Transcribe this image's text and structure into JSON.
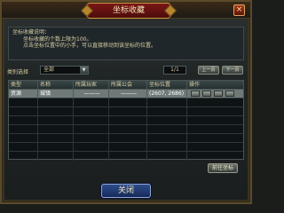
{
  "window": {
    "title": "坐标收藏",
    "close_glyph": "×"
  },
  "description": {
    "heading": "坐标收藏说明：",
    "lines": [
      "坐标收藏的个数上限为100。",
      "点击坐标位置中的小手，可以直接移动到该坐标的位置。"
    ]
  },
  "filter": {
    "label": "类别选择",
    "selected_category": "全部",
    "page_indicator": "1/1",
    "prev_label": "上一页",
    "next_label": "下一页"
  },
  "table": {
    "columns": [
      "类型",
      "名称",
      "所属玩家",
      "所属公会",
      "坐标位置",
      "操作"
    ],
    "rows": [
      {
        "type": "资源",
        "name": "城镇",
        "player": "———",
        "guild": "———",
        "coords": "(2607, 2686)"
      },
      {
        "type": "",
        "name": "",
        "player": "",
        "guild": "",
        "coords": ""
      },
      {
        "type": "",
        "name": "",
        "player": "",
        "guild": "",
        "coords": ""
      },
      {
        "type": "",
        "name": "",
        "player": "",
        "guild": "",
        "coords": ""
      },
      {
        "type": "",
        "name": "",
        "player": "",
        "guild": "",
        "coords": ""
      },
      {
        "type": "",
        "name": "",
        "player": "",
        "guild": "",
        "coords": ""
      },
      {
        "type": "",
        "name": "",
        "player": "",
        "guild": "",
        "coords": ""
      },
      {
        "type": "",
        "name": "",
        "player": "",
        "guild": "",
        "coords": ""
      }
    ]
  },
  "buttons": {
    "goto_label": "前往坐标",
    "close_label": "关闭"
  }
}
